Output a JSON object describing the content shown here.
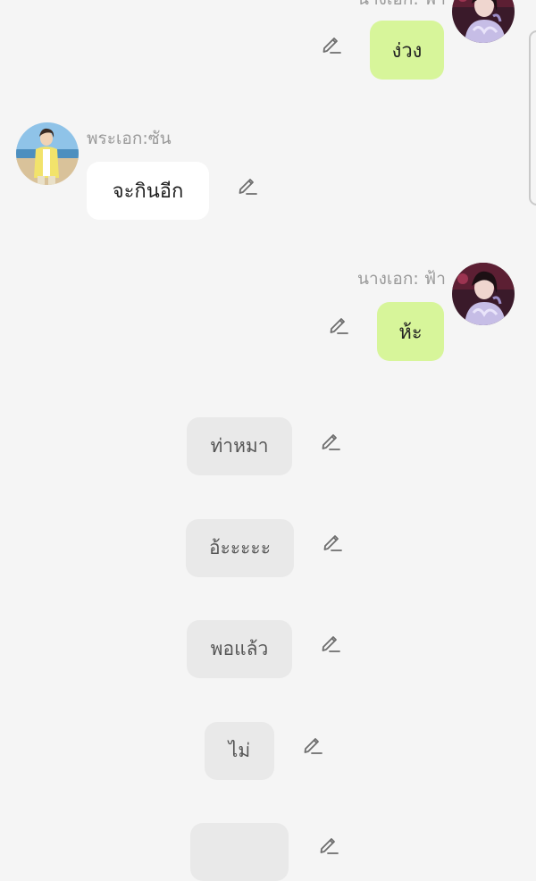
{
  "messages": {
    "top_partial": {
      "speaker": "นางเอก: ฟ้า",
      "text": "ง่วง"
    },
    "hero_message": {
      "speaker": "พระเอก:ซัน",
      "text": "จะกินอีก"
    },
    "heroine_message": {
      "speaker": "นางเอก: ฟ้า",
      "text": "ห้ะ"
    }
  },
  "narration": [
    {
      "text": "ท่าหมา"
    },
    {
      "text": "อ้ะะะะะ"
    },
    {
      "text": "พอแล้ว"
    },
    {
      "text": "ไม่"
    },
    {
      "text": ""
    }
  ],
  "icons": {
    "edit": "pencil-icon",
    "avatar_heroine": "avatar-heroine",
    "avatar_hero": "avatar-hero"
  },
  "colors": {
    "background": "#f5f5f5",
    "green_bubble": "#d7f59a",
    "white_bubble": "#ffffff",
    "narration_bubble": "#e9e9e9",
    "speaker_name": "#9a9a9a"
  }
}
